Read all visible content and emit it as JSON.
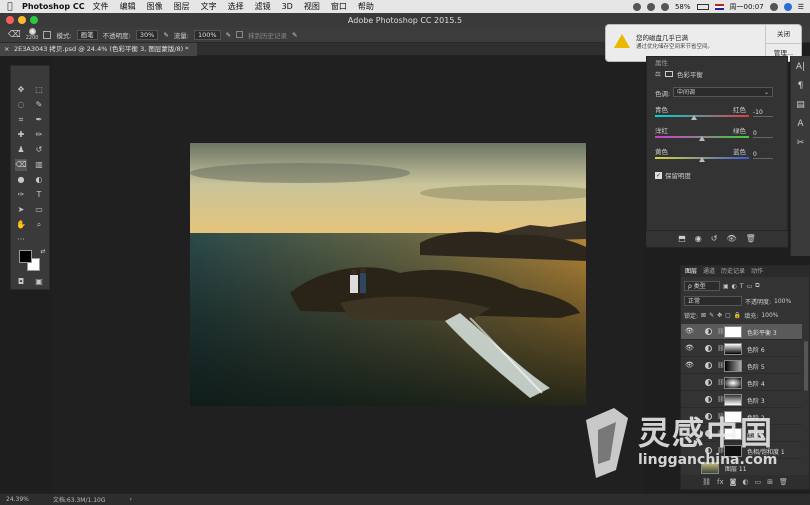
{
  "menubar": {
    "app_name": "Photoshop CC",
    "items": [
      "文件",
      "编辑",
      "图像",
      "图层",
      "文字",
      "选择",
      "滤镜",
      "3D",
      "视图",
      "窗口",
      "帮助"
    ],
    "battery": "58%",
    "clock": "周一00:07"
  },
  "window": {
    "title": "Adobe Photoshop CC 2015.5"
  },
  "options": {
    "brush_size": "2200",
    "mode_label": "模式:",
    "mode_value": "画笔",
    "opacity_label": "不透明度:",
    "opacity_value": "30%",
    "flow_label": "流量:",
    "flow_value": "100%",
    "erase_history": "抹到历史记录"
  },
  "document": {
    "tab_title": "2E3A3043 拷贝.psd @ 24.4% (色彩平衡 3, 图层蒙版/8) *"
  },
  "notification": {
    "title": "您的磁盘几乎已满",
    "body": "通过优化储存空间来节省空间。",
    "close_label": "关闭",
    "manage_label": "管理..."
  },
  "properties": {
    "header": "属性",
    "panel_name": "色彩平衡",
    "tone_label": "色调:",
    "tone_value": "中间调",
    "sliders": [
      {
        "left": "青色",
        "right": "红色",
        "value": "-10",
        "position": 0.41
      },
      {
        "left": "洋红",
        "right": "绿色",
        "value": "0",
        "position": 0.5
      },
      {
        "left": "黄色",
        "right": "蓝色",
        "value": "0",
        "position": 0.5
      }
    ],
    "preserve_luminosity": "保留明度"
  },
  "layers": {
    "tabs": [
      "图层",
      "通道",
      "历史记录",
      "动作"
    ],
    "filter_label": "ρ 类型",
    "blend_mode": "正常",
    "opacity_label": "不透明度:",
    "opacity_value": "100%",
    "lock_label": "锁定:",
    "fill_label": "填充:",
    "fill_value": "100%",
    "rows": [
      {
        "name": "色彩平衡 3",
        "visible": true,
        "selected": true
      },
      {
        "name": "色阶 6",
        "visible": true,
        "selected": false
      },
      {
        "name": "色阶 5",
        "visible": true,
        "selected": false
      },
      {
        "name": "色阶 4",
        "visible": false,
        "selected": false
      },
      {
        "name": "色阶 3",
        "visible": false,
        "selected": false
      },
      {
        "name": "色阶 2",
        "visible": false,
        "selected": false
      },
      {
        "name": "曲线 1",
        "visible": false,
        "selected": false
      },
      {
        "name": "色相/饱和度 1",
        "visible": false,
        "selected": false
      },
      {
        "name": "图层 11",
        "visible": false,
        "selected": false
      }
    ]
  },
  "status": {
    "zoom": "24.39%",
    "doc_size": "文档:63.3M/1.10G"
  },
  "watermark": {
    "brand": "灵感中国",
    "url": "lingganchina.com"
  },
  "colors": {
    "accent": "#1473e6",
    "warning": "#e9b800"
  }
}
